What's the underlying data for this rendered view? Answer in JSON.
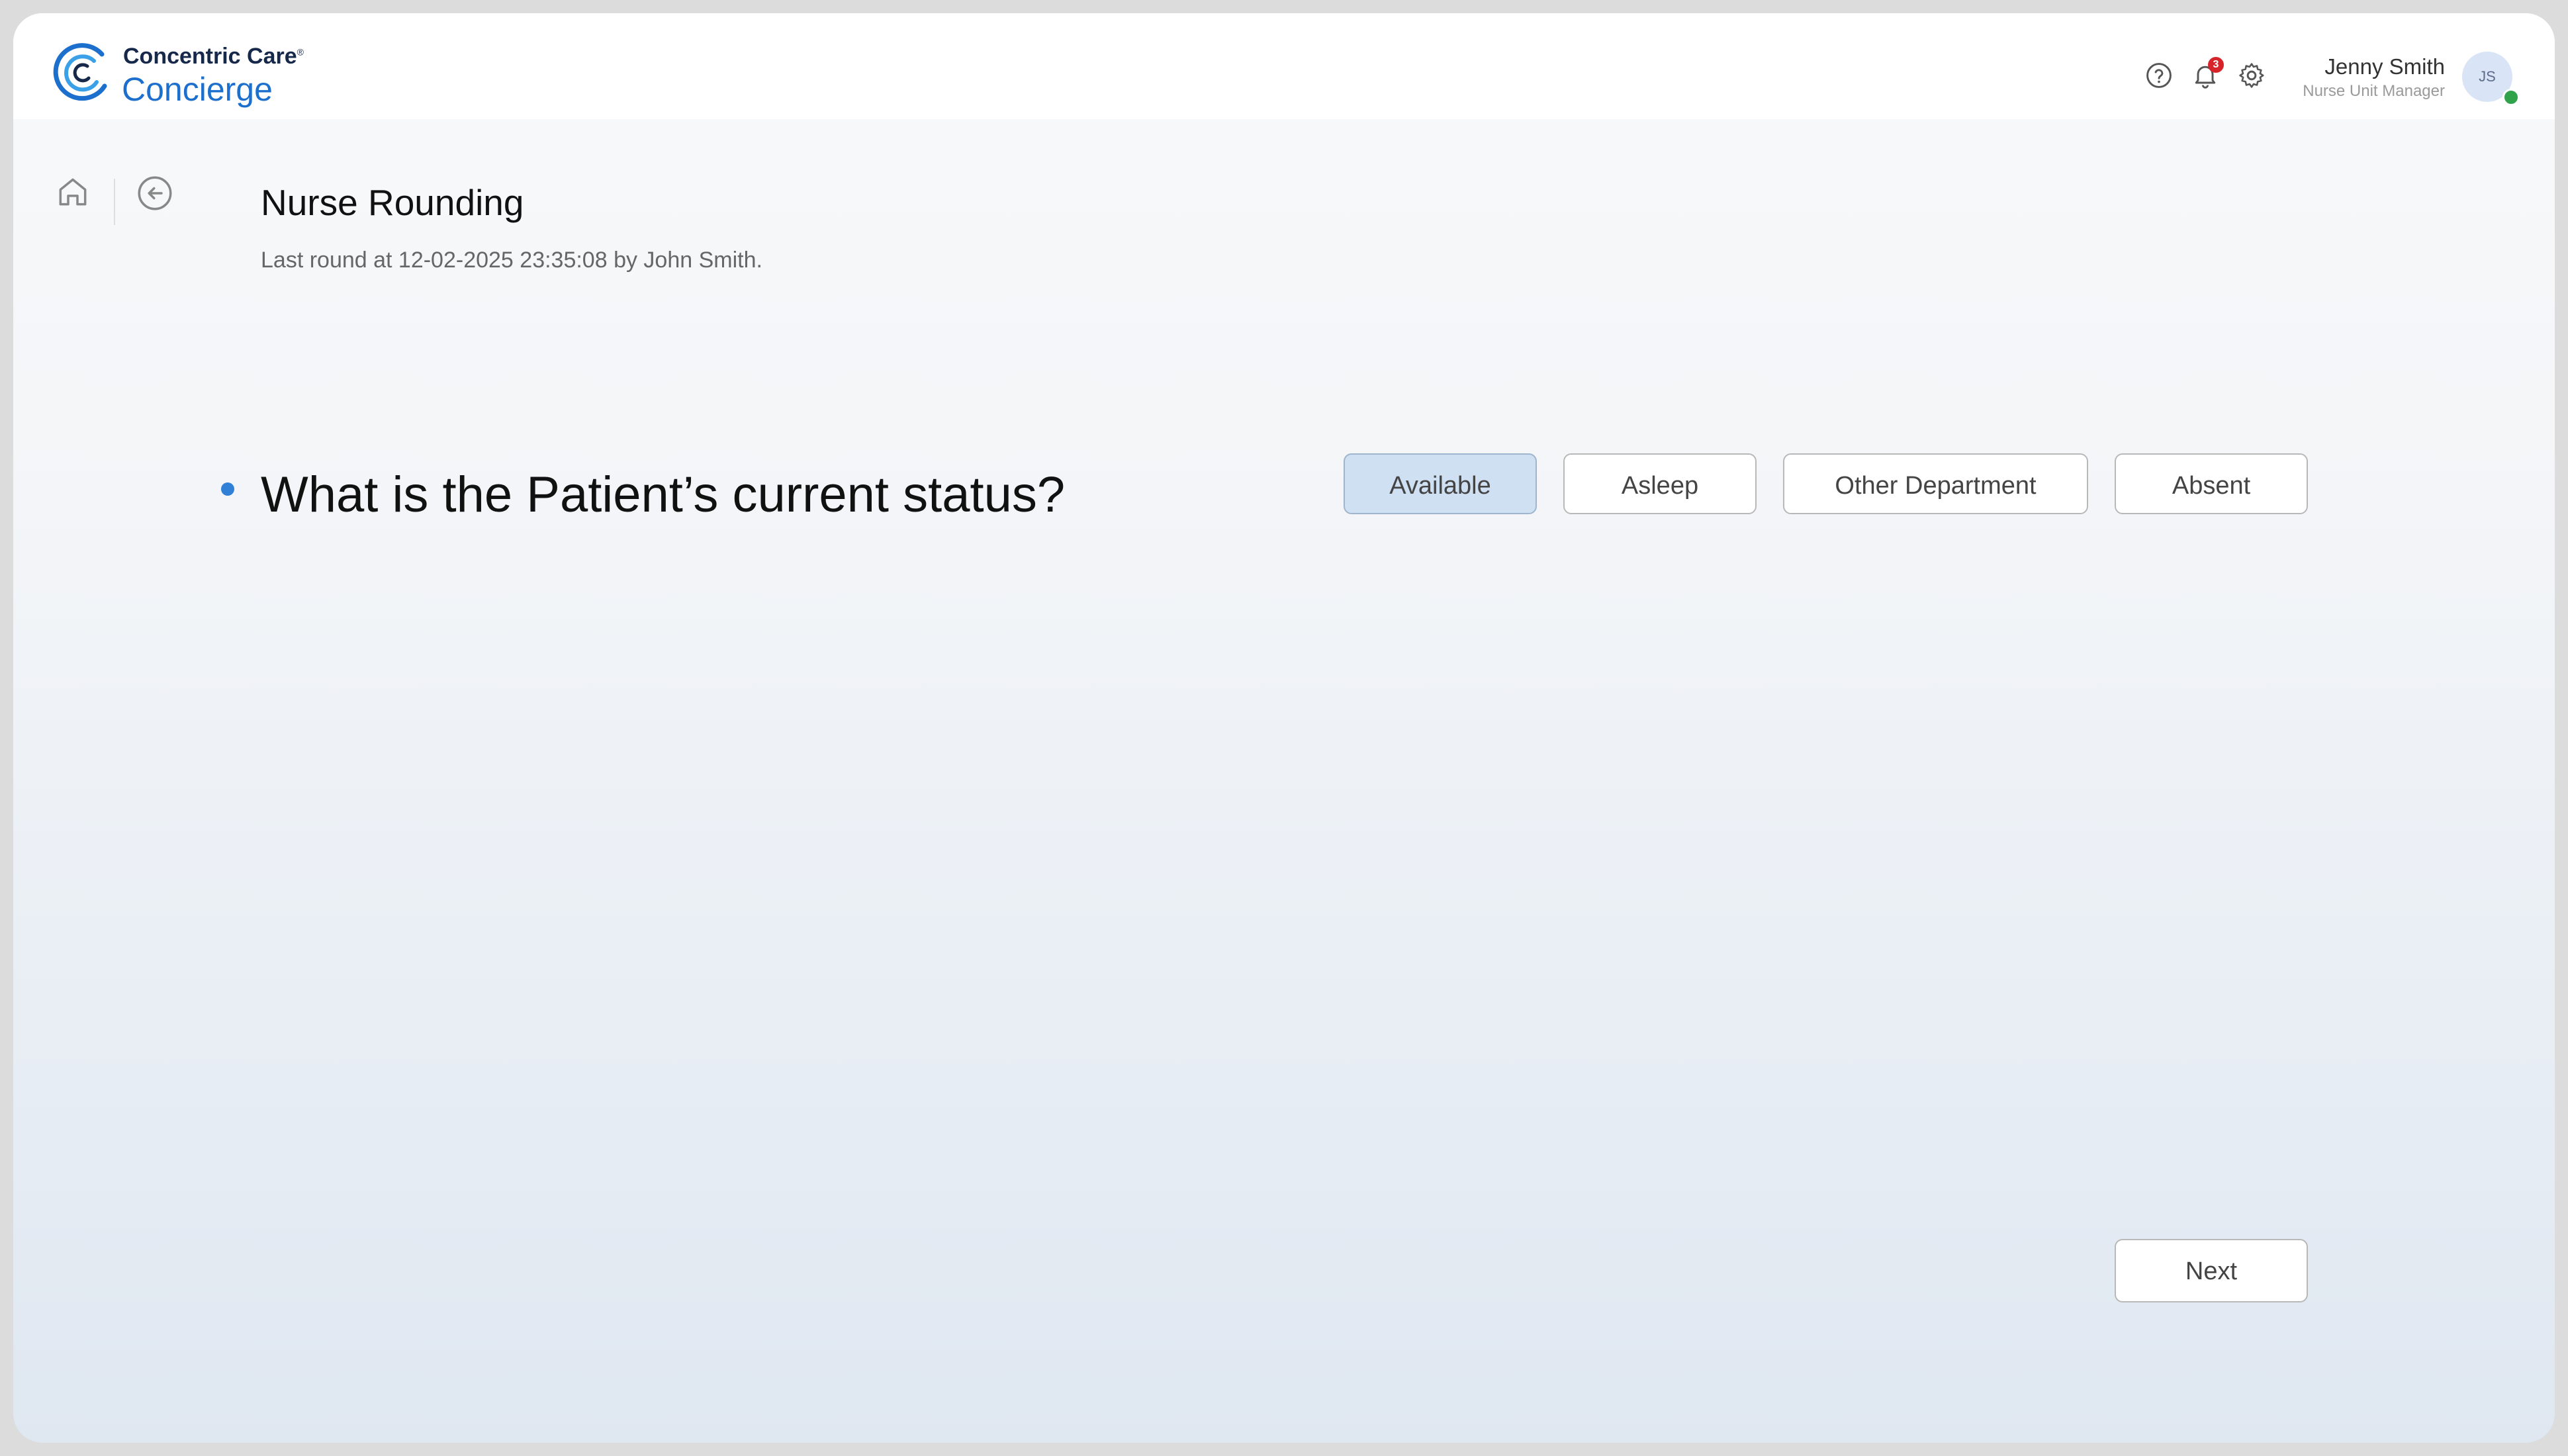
{
  "brand": {
    "name_top": "Concentric Care",
    "registered_mark": "®",
    "product": "Concierge",
    "colors": {
      "primary": "#1d6fce",
      "accent_light": "#3aa0e8",
      "dark": "#17294a"
    }
  },
  "header": {
    "icons": [
      "help-icon",
      "bell-icon",
      "gear-icon"
    ],
    "notifications_count": "3",
    "user": {
      "name": "Jenny Smith",
      "role": "Nurse Unit Manager",
      "initials": "JS",
      "online": true
    }
  },
  "nav": {
    "icons": [
      "home-icon",
      "back-arrow-icon"
    ]
  },
  "page": {
    "title": "Nurse Rounding",
    "subtitle": "Last round at 12-02-2025 23:35:08 by John Smith."
  },
  "question": {
    "text": "What is the Patient’s current status?",
    "options": [
      "Available",
      "Asleep",
      "Other Department",
      "Absent"
    ],
    "selected": "Available"
  },
  "actions": {
    "next_label": "Next"
  }
}
